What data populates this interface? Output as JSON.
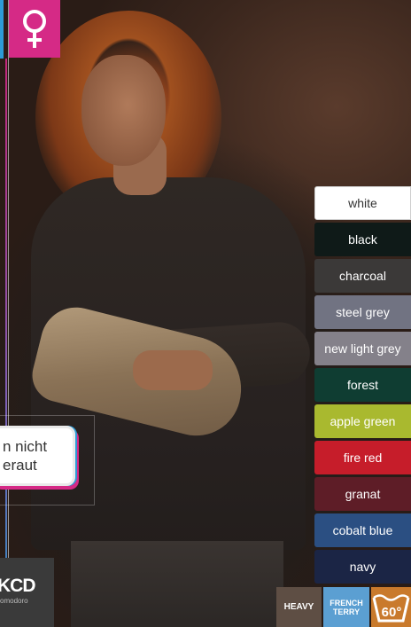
{
  "gender_badge": {
    "symbol": "♀",
    "icon": "female-symbol-icon",
    "color": "#d52a86"
  },
  "callout": {
    "line1": "n nicht",
    "line2": "eraut"
  },
  "brand": {
    "logo_text": "KCD",
    "sub_text": "omodoro"
  },
  "colors": [
    {
      "label": "white",
      "hex": "#ffffff",
      "light": true
    },
    {
      "label": "black",
      "hex": "#0f1a18"
    },
    {
      "label": "charcoal",
      "hex": "#3b3938"
    },
    {
      "label": "steel grey",
      "hex": "#717382"
    },
    {
      "label": "new light grey",
      "hex": "#84818a"
    },
    {
      "label": "forest",
      "hex": "#0f3d32"
    },
    {
      "label": "apple green",
      "hex": "#a9b92f"
    },
    {
      "label": "fire red",
      "hex": "#c61d2a"
    },
    {
      "label": "granat",
      "hex": "#5e1d27"
    },
    {
      "label": "cobalt blue",
      "hex": "#2b4f82"
    },
    {
      "label": "navy",
      "hex": "#1b2545"
    }
  ],
  "badges": {
    "heavy": "HEAVY",
    "french_terry_line1": "FRENCH",
    "french_terry_line2": "TERRY",
    "wash_temp": "60°",
    "wash_icon": "wash-60-icon"
  }
}
